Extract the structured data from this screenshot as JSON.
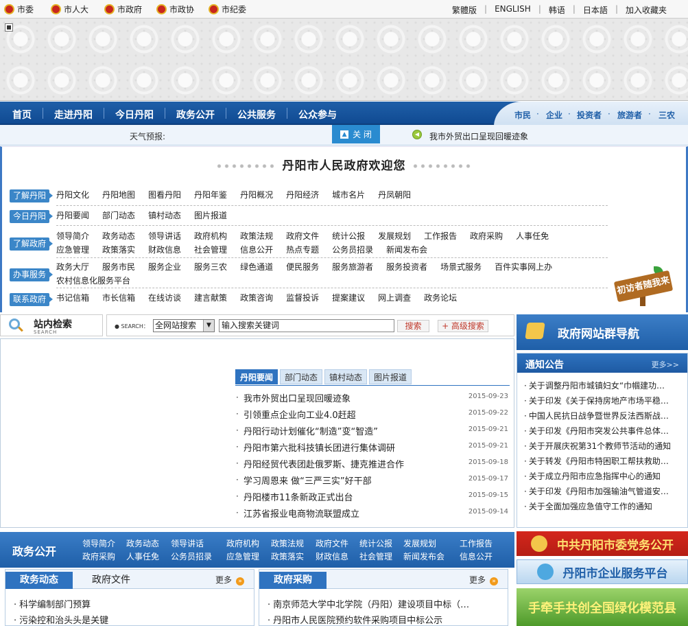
{
  "topbar": {
    "left_links": [
      "市委",
      "市人大",
      "市政府",
      "市政协",
      "市纪委"
    ],
    "right_links": [
      "繁體版",
      "ENGLISH",
      "韩语",
      "日本語",
      "加入收藏夹"
    ]
  },
  "nav": {
    "items": [
      "首页",
      "走进丹阳",
      "今日丹阳",
      "政务公开",
      "公共服务",
      "公众参与"
    ],
    "audience": [
      "市民",
      "企业",
      "投资者",
      "旅游者",
      "三农"
    ]
  },
  "subbar": {
    "weather_label": "天气预报:",
    "close_label": "关 闭",
    "ticker": "我市外贸出口呈现回暖迹象"
  },
  "welcome": {
    "title": "丹阳市人民政府欢迎您",
    "categories": [
      {
        "badge": "了解丹阳",
        "links": [
          "丹阳文化",
          "丹阳地图",
          "图看丹阳",
          "丹阳年鉴",
          "丹阳概况",
          "丹阳经济",
          "城市名片",
          "丹凤朝阳"
        ]
      },
      {
        "badge": "今日丹阳",
        "links": [
          "丹阳要闻",
          "部门动态",
          "镇村动态",
          "图片报道"
        ]
      },
      {
        "badge": "了解政府",
        "links": [
          "领导简介",
          "政务动态",
          "领导讲话",
          "政府机构",
          "政策法规",
          "政府文件",
          "统计公报",
          "发展规划",
          "工作报告",
          "政府采购",
          "人事任免",
          "应急管理",
          "政策落实",
          "财政信息",
          "社会管理",
          "信息公开",
          "热点专题",
          "公务员招录",
          "新闻发布会"
        ]
      },
      {
        "badge": "办事服务",
        "links": [
          "政务大厅",
          "服务市民",
          "服务企业",
          "服务三农",
          "绿色通道",
          "便民服务",
          "服务旅游者",
          "服务投资者",
          "场景式服务",
          "百件实事网上办",
          "农村信息化服务平台"
        ]
      },
      {
        "badge": "联系政府",
        "links": [
          "书记信箱",
          "市长信箱",
          "在线访谈",
          "建言献策",
          "政策咨询",
          "监督投诉",
          "提案建议",
          "网上调查",
          "政务论坛"
        ]
      }
    ],
    "signpost": "初访者随我来"
  },
  "search": {
    "title": "站内检索",
    "subtitle": "SEARCH",
    "label": "● SEARCH：",
    "scope": "全网站搜索",
    "placeholder": "输入搜索关键词",
    "search_btn": "搜索",
    "advanced_btn": "+ 高级搜索"
  },
  "news": {
    "tabs": [
      "丹阳要闻",
      "部门动态",
      "镇村动态",
      "图片报道"
    ],
    "items": [
      {
        "title": "我市外贸出口呈现回暖迹象",
        "date": "2015-09-23"
      },
      {
        "title": "引领重点企业向工业4.0赶超",
        "date": "2015-09-22"
      },
      {
        "title": "丹阳行动计划催化“制造”变“智造”",
        "date": "2015-09-21"
      },
      {
        "title": "丹阳市第六批科技镇长团进行集体调研",
        "date": "2015-09-21"
      },
      {
        "title": "丹阳经贸代表团赴俄罗斯、捷克推进合作",
        "date": "2015-09-18"
      },
      {
        "title": "学习周恩来 做“三严三实”好干部",
        "date": "2015-09-17"
      },
      {
        "title": "丹阳楼市11条新政正式出台",
        "date": "2015-09-15"
      },
      {
        "title": "江苏省报业电商物流联盟成立",
        "date": "2015-09-14"
      }
    ]
  },
  "site_nav": {
    "title": "政府网站群导航"
  },
  "notice": {
    "title": "通知公告",
    "more": "更多>>",
    "items": [
      "关于调整丹阳市城镇妇女“巾帼建功…",
      "关于印发《关于保持房地产市场平稳…",
      "中国人民抗日战争暨世界反法西斯战…",
      "关于印发《丹阳市突发公共事件总体…",
      "关于开展庆祝第31个教师节活动的通知",
      "关于转发《丹阳市特困职工帮扶救助…",
      "关于成立丹阳市应急指挥中心的通知",
      "关于印发《丹阳市加强输油气管道安…",
      "关于全面加强应急值守工作的通知"
    ]
  },
  "gov_open": {
    "title": "政务公开",
    "row1": [
      "领导简介",
      "政务动态",
      "领导讲话",
      "政府机构",
      "政策法规",
      "政府文件",
      "统计公报",
      "发展规划",
      "工作报告"
    ],
    "row2": [
      "政府采购",
      "人事任免",
      "公务员招录",
      "应急管理",
      "政策落实",
      "财政信息",
      "社会管理",
      "新闻发布会",
      "信息公开"
    ]
  },
  "box_dynamics": {
    "tabs": [
      "政务动态",
      "政府文件"
    ],
    "more": "更多",
    "items": [
      "科学编制部门预算",
      "污染控和治头头是关键"
    ]
  },
  "box_procure": {
    "tab": "政府采购",
    "more": "更多",
    "items": [
      "南京师范大学中北学院（丹阳）建设项目中标（…",
      "丹阳市人民医院预约软件采购项目中标公示"
    ]
  },
  "banners": {
    "party": "中共丹阳市委党务公开",
    "enterprise": "丹阳市企业服务平台",
    "green": "手牵手共创全国绿化模范县"
  },
  "colors": {
    "primary": "#1f5fa8",
    "accent": "#3b86c8",
    "party_red": "#d4261c"
  }
}
